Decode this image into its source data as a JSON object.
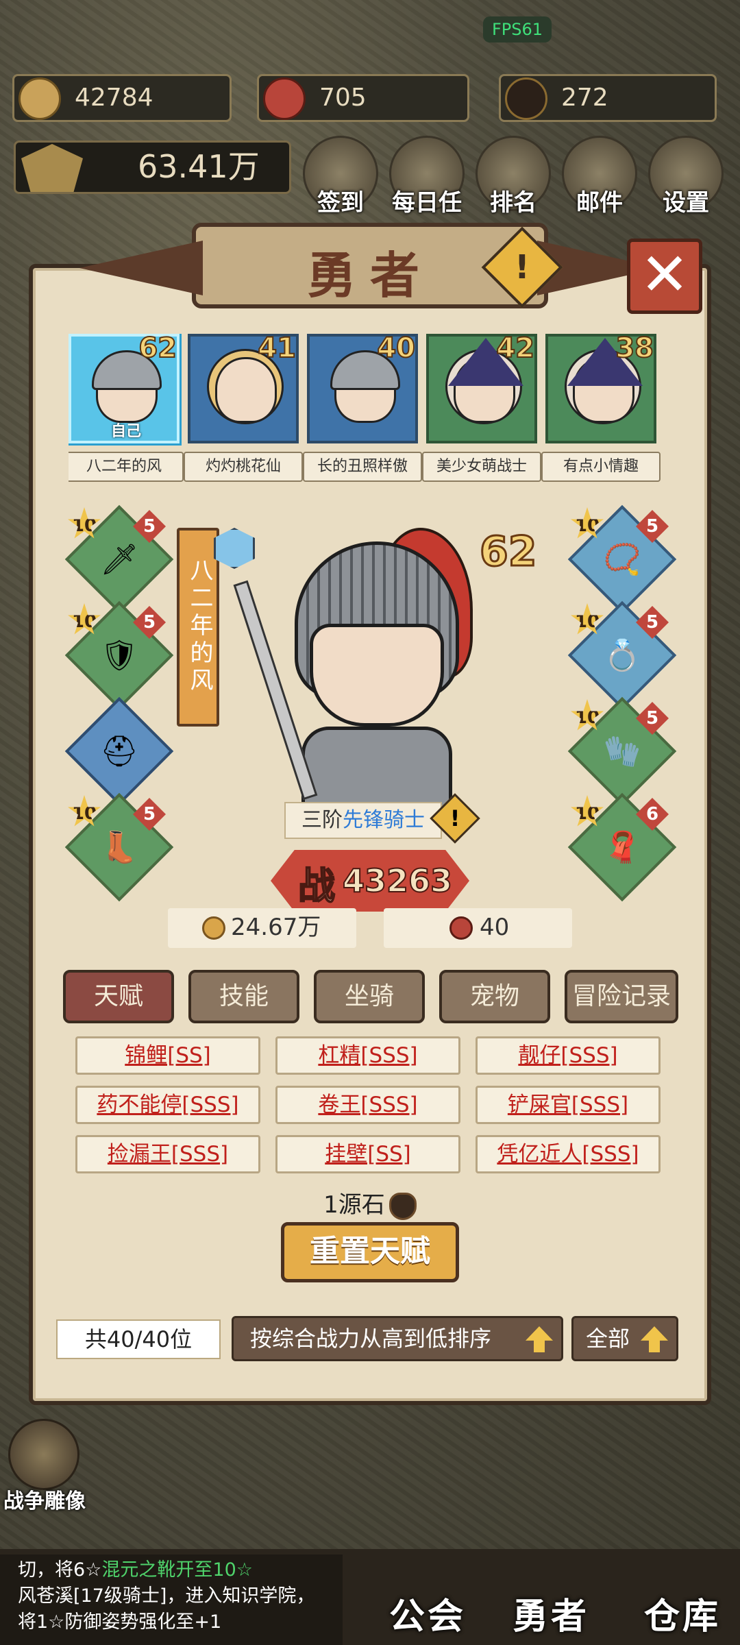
{
  "status": {
    "fps": "FPS61"
  },
  "resources": {
    "gold": "42784",
    "honor": "705",
    "source_stone": "272"
  },
  "power_total": "63.41万",
  "top_menu": [
    "签到",
    "每日任务",
    "排名",
    "邮件",
    "设置"
  ],
  "modal": {
    "title": "勇者",
    "close_icon": "close-icon"
  },
  "heroes": [
    {
      "name": "八二年的风",
      "level": "62",
      "tag": "自己",
      "color": "#59c4e8"
    },
    {
      "name": "灼灼桃花仙",
      "level": "41",
      "color": "#3f73a8"
    },
    {
      "name": "长的丑照样傲",
      "level": "40",
      "color": "#3f73a8"
    },
    {
      "name": "美少女萌战士",
      "level": "42",
      "color": "#4c8a5a"
    },
    {
      "name": "有点小情趣",
      "level": "38",
      "color": "#4c8a5a"
    }
  ],
  "character": {
    "name": "八二年的风",
    "level": "62",
    "class_prefix": "三阶",
    "class_name": "先锋骑士",
    "battle_label": "战",
    "battle_power": "43263",
    "gold": "24.67万",
    "honor": "40"
  },
  "equipment_left": [
    {
      "star": "10",
      "grade": "5"
    },
    {
      "star": "10",
      "grade": "5"
    },
    {
      "star": "",
      "grade": ""
    },
    {
      "star": "10",
      "grade": "5"
    }
  ],
  "equipment_right": [
    {
      "star": "10",
      "grade": "5"
    },
    {
      "star": "10",
      "grade": "5"
    },
    {
      "star": "10",
      "grade": "5"
    },
    {
      "star": "10",
      "grade": "6"
    }
  ],
  "tabs": [
    "天赋",
    "技能",
    "坐骑",
    "宠物",
    "冒险记录"
  ],
  "talents": [
    "锦鲤[SS]",
    "杠精[SSS]",
    "靓仔[SSS]",
    "药不能停[SSS]",
    "卷王[SSS]",
    "铲屎官[SSS]",
    "捡漏王[SSS]",
    "挂壁[SS]",
    "凭亿近人[SSS]"
  ],
  "reset": {
    "cost": "1源石",
    "button": "重置天赋"
  },
  "footer": {
    "count": "共40/40位",
    "sort": "按综合战力从高到低排序",
    "filter": "全部"
  },
  "bottom": {
    "ticker_line1a": "切，将6☆",
    "ticker_line1b": "混元之靴开至10☆",
    "ticker_line2": "风苍溪[17级骑士]，进入知识学院，",
    "ticker_line3": "将1☆防御姿势强化至+1",
    "nav": [
      "公会",
      "勇者",
      "仓库"
    ],
    "side_label": "战争雕像"
  },
  "colors": {
    "accent_gold": "#e5ad49",
    "talent_red": "#c0201b",
    "class_blue": "#2e7bd6"
  }
}
